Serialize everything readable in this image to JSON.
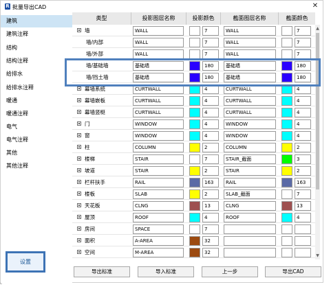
{
  "window": {
    "title": "批量导出CAD",
    "app_icon": "R",
    "close_label": "✕"
  },
  "sidebar": {
    "items": [
      {
        "label": "建筑"
      },
      {
        "label": "建筑注释"
      },
      {
        "label": "结构"
      },
      {
        "label": "结构注释"
      },
      {
        "label": "给排水"
      },
      {
        "label": "给排水注释"
      },
      {
        "label": "暖通"
      },
      {
        "label": "暖通注释"
      },
      {
        "label": "电气"
      },
      {
        "label": "电气注释"
      },
      {
        "label": "其他"
      },
      {
        "label": "其他注释"
      }
    ],
    "settings_label": "设置"
  },
  "table": {
    "headers": [
      "类型",
      "投影图层名称",
      "投影颜色",
      "截面图层名称",
      "截面颜色"
    ],
    "rows": [
      {
        "type": "墙",
        "expand": true,
        "proj_layer": "WALL",
        "proj_color_hex": "#ffffff",
        "proj_color": "7",
        "cut_layer": "WALL",
        "cut_color_hex": "#ffffff",
        "cut_color": "7"
      },
      {
        "type": "墙/内部",
        "expand": false,
        "proj_layer": "WALL",
        "proj_color_hex": "#ffffff",
        "proj_color": "7",
        "cut_layer": "WALL",
        "cut_color_hex": "#ffffff",
        "cut_color": "7"
      },
      {
        "type": "墙/外部",
        "expand": false,
        "proj_layer": "WALL",
        "proj_color_hex": "#ffffff",
        "proj_color": "7",
        "cut_layer": "WALL",
        "cut_color_hex": "#ffffff",
        "cut_color": "7"
      },
      {
        "type": "墙/基础墙",
        "expand": false,
        "proj_layer": "基础墙",
        "proj_color_hex": "#2a00ff",
        "proj_color": "180",
        "cut_layer": "基础墙",
        "cut_color_hex": "#2a00ff",
        "cut_color": "180"
      },
      {
        "type": "墙/挡土墙",
        "expand": false,
        "proj_layer": "基础墙",
        "proj_color_hex": "#2a00ff",
        "proj_color": "180",
        "cut_layer": "基础墙",
        "cut_color_hex": "#2a00ff",
        "cut_color": "180"
      },
      {
        "type": "幕墙系统",
        "expand": true,
        "proj_layer": "CURTWALL",
        "proj_color_hex": "#00ffff",
        "proj_color": "4",
        "cut_layer": "CURTWALL",
        "cut_color_hex": "#00ffff",
        "cut_color": "4"
      },
      {
        "type": "幕墙嵌板",
        "expand": true,
        "proj_layer": "CURTWALL",
        "proj_color_hex": "#00ffff",
        "proj_color": "4",
        "cut_layer": "CURTWALL",
        "cut_color_hex": "#00ffff",
        "cut_color": "4"
      },
      {
        "type": "幕墙竖梃",
        "expand": true,
        "proj_layer": "CURTWALL",
        "proj_color_hex": "#00ffff",
        "proj_color": "4",
        "cut_layer": "CURTWALL",
        "cut_color_hex": "#00ffff",
        "cut_color": "4"
      },
      {
        "type": "门",
        "expand": true,
        "proj_layer": "WINDOW",
        "proj_color_hex": "#00ffff",
        "proj_color": "4",
        "cut_layer": "WINDOW",
        "cut_color_hex": "#00ffff",
        "cut_color": "4"
      },
      {
        "type": "窗",
        "expand": true,
        "proj_layer": "WINDOW",
        "proj_color_hex": "#00ffff",
        "proj_color": "4",
        "cut_layer": "WINDOW",
        "cut_color_hex": "#00ffff",
        "cut_color": "4"
      },
      {
        "type": "柱",
        "expand": true,
        "proj_layer": "COLUMN",
        "proj_color_hex": "#ffff00",
        "proj_color": "2",
        "cut_layer": "COLUMN",
        "cut_color_hex": "#ffff00",
        "cut_color": "2"
      },
      {
        "type": "楼梯",
        "expand": true,
        "proj_layer": "STAIR",
        "proj_color_hex": "#ffffff",
        "proj_color": "7",
        "cut_layer": "STAIR_截面",
        "cut_color_hex": "#00ff00",
        "cut_color": "3"
      },
      {
        "type": "坡道",
        "expand": true,
        "proj_layer": "STAIR",
        "proj_color_hex": "#ffff00",
        "proj_color": "2",
        "cut_layer": "STAIR",
        "cut_color_hex": "#ffff00",
        "cut_color": "2"
      },
      {
        "type": "栏杆扶手",
        "expand": true,
        "proj_layer": "RAIL",
        "proj_color_hex": "#5a6aa6",
        "proj_color": "163",
        "cut_layer": "RAIL",
        "cut_color_hex": "#5a6aa6",
        "cut_color": "163"
      },
      {
        "type": "楼板",
        "expand": true,
        "proj_layer": "SLAB",
        "proj_color_hex": "#ffff00",
        "proj_color": "2",
        "cut_layer": "SLAB_截面",
        "cut_color_hex": "#ffffff",
        "cut_color": "7"
      },
      {
        "type": "天花板",
        "expand": true,
        "proj_layer": "CLNG",
        "proj_color_hex": "#9e5050",
        "proj_color": "13",
        "cut_layer": "CLNG",
        "cut_color_hex": "#9e5050",
        "cut_color": "13"
      },
      {
        "type": "屋顶",
        "expand": true,
        "proj_layer": "ROOF",
        "proj_color_hex": "#00ffff",
        "proj_color": "4",
        "cut_layer": "ROOF",
        "cut_color_hex": "#00ffff",
        "cut_color": "4"
      },
      {
        "type": "房间",
        "expand": true,
        "proj_layer": "SPACE",
        "proj_color_hex": "#ffffff",
        "proj_color": "7",
        "cut_layer": "",
        "cut_color_hex": "#ffffff",
        "cut_color": ""
      },
      {
        "type": "面积",
        "expand": true,
        "proj_layer": "A-AREA",
        "proj_color_hex": "#9c4a10",
        "proj_color": "32",
        "cut_layer": "",
        "cut_color_hex": "#ffffff",
        "cut_color": ""
      },
      {
        "type": "空间",
        "expand": true,
        "proj_layer": "M-AREA",
        "proj_color_hex": "#9c4a10",
        "proj_color": "32",
        "cut_layer": "",
        "cut_color_hex": "#ffffff",
        "cut_color": ""
      }
    ]
  },
  "buttons": {
    "export_standard": "导出标准",
    "import_standard": "导入标准",
    "prev_step": "上一步",
    "export_cad": "导出CAD"
  },
  "colors": {
    "sidebar_selected": "#cde4f5",
    "highlight_border": "#4f80bd"
  }
}
